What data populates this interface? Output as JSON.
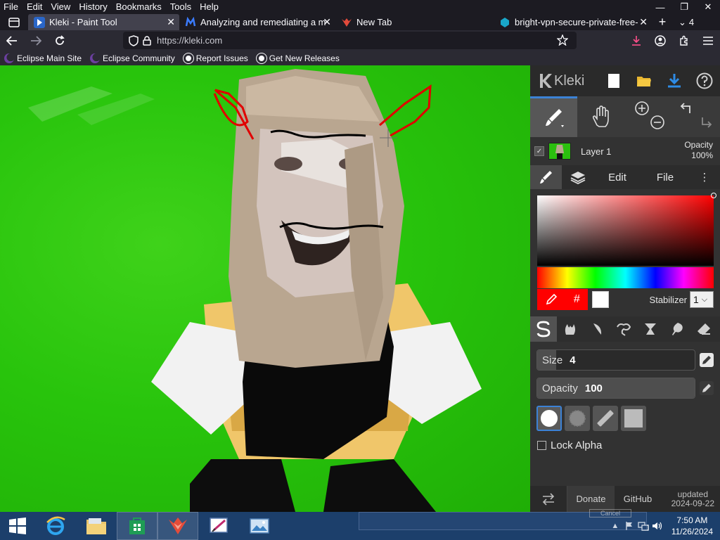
{
  "menubar": {
    "items": [
      "File",
      "Edit",
      "View",
      "History",
      "Bookmarks",
      "Tools",
      "Help"
    ],
    "window_controls": [
      "minimize-icon",
      "restore-icon",
      "close-icon"
    ]
  },
  "tabs": [
    {
      "title": "Kleki - Paint Tool",
      "active": true,
      "icon": "kleki-favicon"
    },
    {
      "title": "Analyzing and remediating a m",
      "active": false,
      "icon": "malwarebytes-favicon"
    },
    {
      "title": "New Tab",
      "active": false,
      "icon": "firefox-favicon"
    },
    {
      "title": "bright-vpn-secure-private-free-",
      "active": false,
      "icon": "brightvpn-favicon"
    }
  ],
  "tab_list_count": "4",
  "navbar": {
    "url": "https://kleki.com"
  },
  "bookmarks": [
    {
      "label": "Eclipse Main Site",
      "icon": "eclipse-icon"
    },
    {
      "label": "Eclipse Community",
      "icon": "eclipse-icon"
    },
    {
      "label": "Report Issues",
      "icon": "github-icon"
    },
    {
      "label": "Get New Releases",
      "icon": "github-icon"
    }
  ],
  "kleki": {
    "logo_text": "Kleki",
    "layer": {
      "name": "Layer 1",
      "opacity_label": "Opacity",
      "opacity_value": "100%"
    },
    "tabs": [
      "Edit",
      "File"
    ],
    "color": {
      "primary": "#ff0000",
      "secondary": "#ffffff",
      "hash_label": "#"
    },
    "stabilizer": {
      "label": "Stabilizer",
      "value": "1"
    },
    "size": {
      "label": "Size",
      "value": "4",
      "fraction": 0.12
    },
    "opacity": {
      "label": "Opacity",
      "value": "100",
      "fraction": 1.0
    },
    "lock_alpha": "Lock Alpha",
    "bottom": {
      "donate": "Donate",
      "github": "GitHub",
      "updated_label": "updated",
      "updated_date": "2024-09-22"
    }
  },
  "taskbar": {
    "clock_time": "7:50 AM",
    "clock_date": "11/26/2024",
    "ghost_cancel": "Cancel"
  }
}
